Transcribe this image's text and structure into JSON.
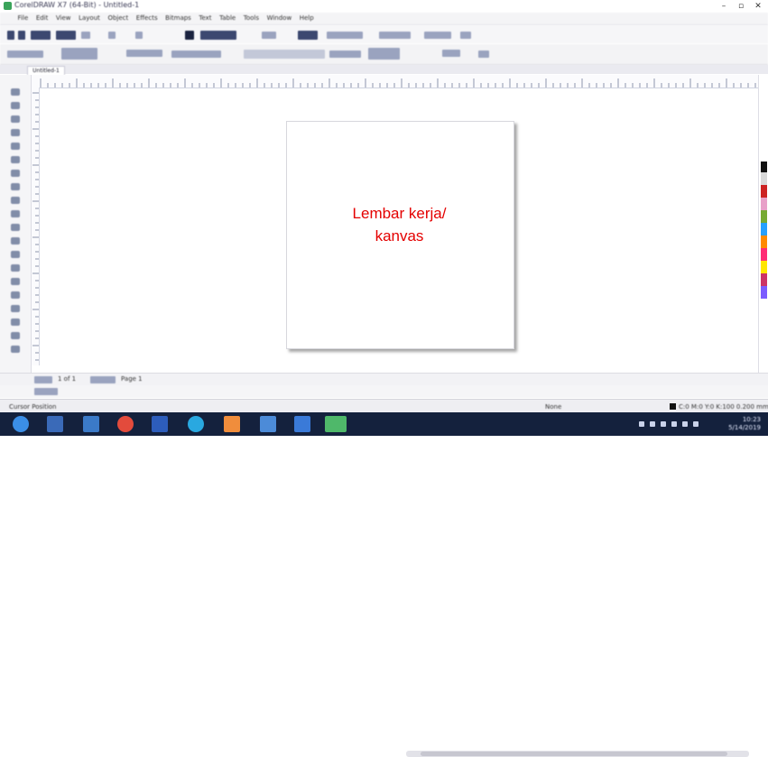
{
  "window": {
    "title": "CorelDRAW X7 (64-Bit) - Untitled-1"
  },
  "menu": [
    "File",
    "Edit",
    "View",
    "Layout",
    "Object",
    "Effects",
    "Bitmaps",
    "Text",
    "Table",
    "Tools",
    "Window",
    "Help"
  ],
  "document_tab": "Untitled-1",
  "canvas_label": {
    "line1": "Lembar kerja/",
    "line2": "kanvas"
  },
  "page_navigator": {
    "page_label": "Page 1",
    "page_count": "1 of 1"
  },
  "status": {
    "left": "Cursor Position",
    "fill": "None",
    "outline": "C:0 M:0 Y:0 K:100 0.200 mm"
  },
  "taskbar": {
    "time": "10:23",
    "date": "5/14/2019"
  },
  "colors": {
    "label": "#e40000",
    "taskbar": "#14213d",
    "palette": [
      "#111111",
      "#d8d8d8",
      "#c22",
      "#e8a0c8",
      "#7a3",
      "#25a0ff",
      "#ff8a00",
      "#ff2d75",
      "#ffe600",
      "#c36",
      "#7b5cff",
      "#fff"
    ]
  },
  "icons": [
    "start-icon",
    "file-manager-icon",
    "media-icon",
    "chrome-icon",
    "mail-icon",
    "edge-icon",
    "store-icon",
    "folder-icon",
    "word-icon",
    "coreldraw-icon"
  ]
}
